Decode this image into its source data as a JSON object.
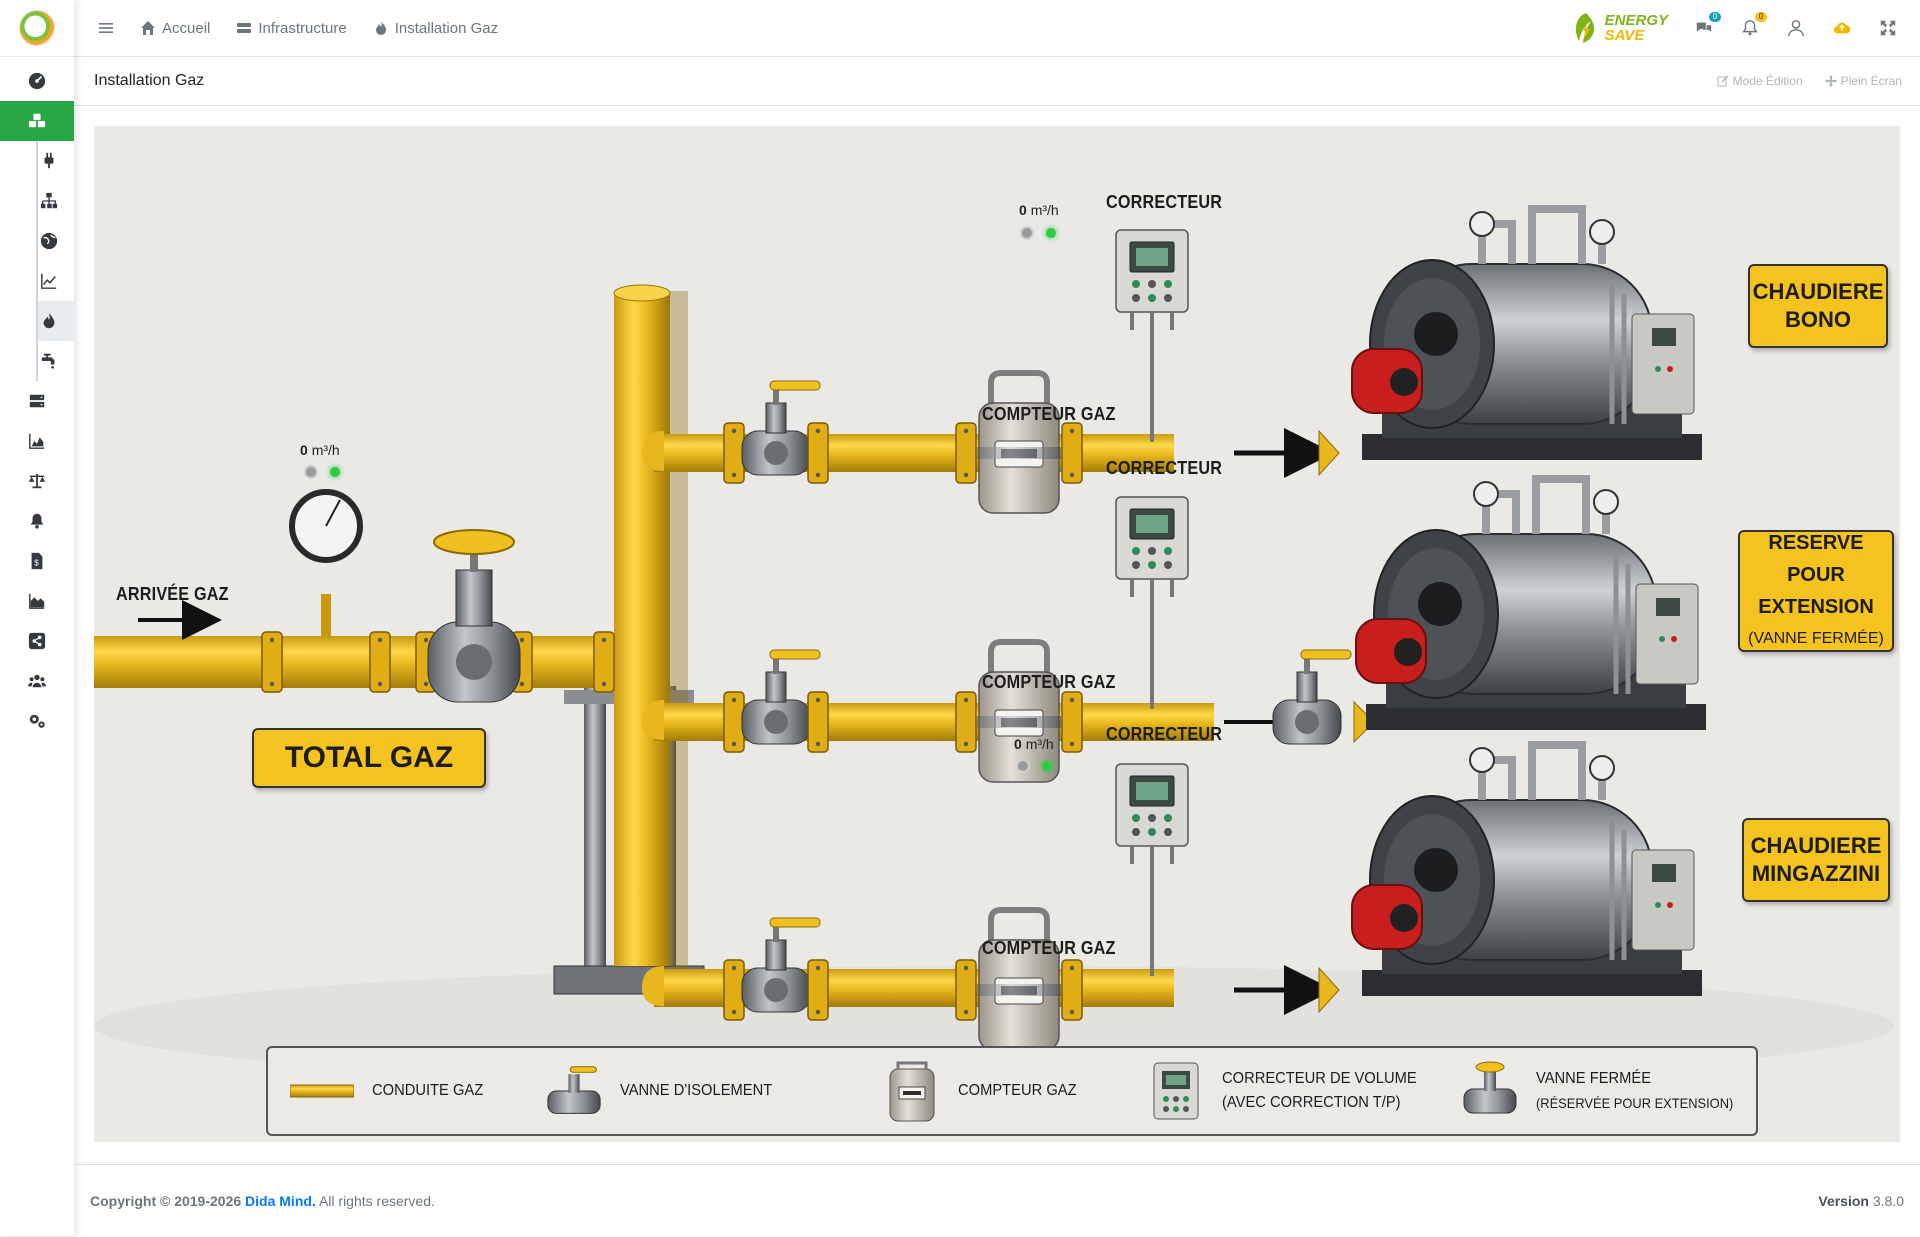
{
  "topbar": {
    "breadcrumb": [
      {
        "label": "Accueil",
        "icon": "home-icon"
      },
      {
        "label": "Infrastructure",
        "icon": "server-icon"
      },
      {
        "label": "Installation Gaz",
        "icon": "fire-icon"
      }
    ],
    "logo_line1": "ENERGY",
    "logo_line2": "SAVE",
    "notif_badge_1": "0",
    "notif_badge_2": "0",
    "badge_colors": {
      "info": "#17a2b8",
      "warning": "#ffc107"
    }
  },
  "page": {
    "title": "Installation Gaz",
    "edit_mode": "Mode Édition",
    "fullscreen": "Plein Écran"
  },
  "diagram": {
    "inlet_label": "ARRIVÉE GAZ",
    "total_label": "TOTAL GAZ",
    "meter_label": "COMPTEUR GAZ",
    "corrector_label": "CORRECTEUR",
    "flow_unit": "m³/h",
    "total_flow": "0",
    "line1_flow": "0",
    "line3_flow": "0",
    "boiler1": {
      "line1": "CHAUDIERE",
      "line2": "BONO"
    },
    "boiler2": {
      "line1": "RESERVE POUR",
      "line2": "EXTENSION",
      "line3": "(VANNE FERMÉE)"
    },
    "boiler3": {
      "line1": "CHAUDIERE",
      "line2": "MINGAZZINI"
    },
    "colors": {
      "pipe": "#e8b71d",
      "accent_green": "#28a745",
      "led_on": "#2ecc40",
      "led_off": "#9a9a9a"
    }
  },
  "legend": {
    "pipe": "CONDUITE GAZ",
    "isolation_valve": "VANNE D'ISOLEMENT",
    "meter": "COMPTEUR GAZ",
    "corrector_line1": "CORRECTEUR DE VOLUME",
    "corrector_line2": "(AVEC CORRECTION T/P)",
    "closed_valve_line1": "VANNE FERMÉE",
    "closed_valve_line2": "(RÉSERVÉE POUR EXTENSION)"
  },
  "footer": {
    "copyright": "Copyright © 2019-2026",
    "company": "Dida Mind.",
    "rights": "All rights reserved.",
    "version_label": "Version",
    "version": "3.8.0"
  }
}
